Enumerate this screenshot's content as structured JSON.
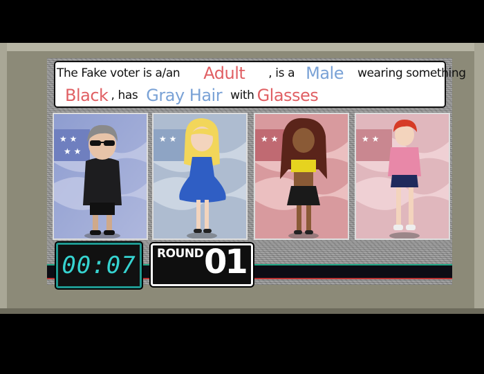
{
  "clue": {
    "line1": {
      "prefix": "The Fake voter is a/an",
      "age": "Adult",
      "mid": ", is a",
      "gender": "Male",
      "suffix": "wearing something"
    },
    "line2": {
      "color": "Black",
      "mid1": ", has",
      "hair": "Gray Hair",
      "mid2": "with",
      "accessory": "Glasses"
    }
  },
  "timer": {
    "value": "00:07"
  },
  "round": {
    "label": "ROUND",
    "number": "01"
  },
  "candidates": [
    {
      "icon": "gray-hair-sunglasses-man-icon"
    },
    {
      "icon": "blonde-girl-blue-dress-icon"
    },
    {
      "icon": "dreadlocks-woman-yellow-top-icon"
    },
    {
      "icon": "redhead-girl-pink-sweater-icon"
    }
  ],
  "colors": {
    "red": "#e05f63",
    "blue": "#7aa2d6",
    "timer": "#36d3d0"
  }
}
